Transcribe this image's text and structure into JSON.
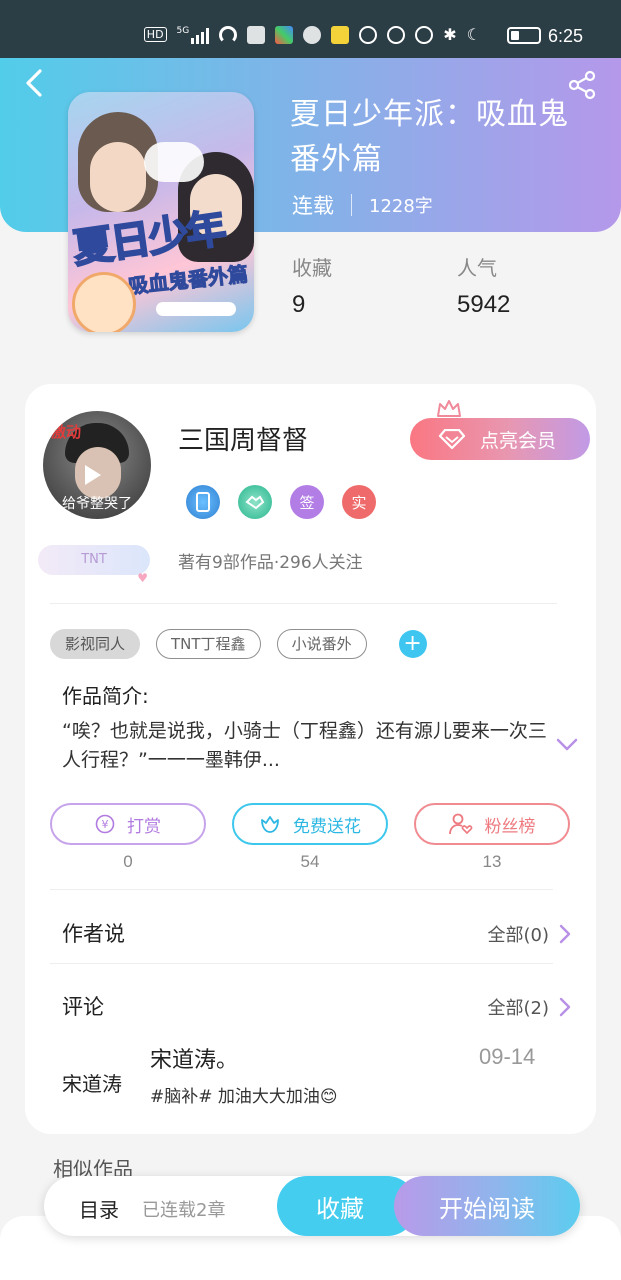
{
  "status_bar": {
    "time": "6:25",
    "network": "5G",
    "hd": "HD",
    "icons": [
      "hd-icon",
      "signal-icon",
      "wifi-icon",
      "tv-icon",
      "app-icon",
      "qq-icon",
      "chat-icon",
      "nfc-icon",
      "eye-icon",
      "alarm-icon",
      "bluetooth-icon",
      "moon-icon",
      "battery-icon"
    ]
  },
  "book": {
    "title": "夏日少年派：吸血鬼番外篇",
    "status": "连载",
    "word_count": "1228字",
    "stats": [
      {
        "label": "收藏",
        "value": "9"
      },
      {
        "label": "人气",
        "value": "5942"
      }
    ],
    "cover_logo": "夏日少年派",
    "cover_subtitle": "吸血鬼番外篇"
  },
  "author": {
    "name": "三国周督督",
    "avatar_caption": "给爷整哭了",
    "avatar_red_text": "激动",
    "fan_badge": "TNT",
    "badges": [
      {
        "name": "phone-badge-icon",
        "text": ""
      },
      {
        "name": "handshake-badge-icon",
        "text": ""
      },
      {
        "name": "sign-badge",
        "text": "签"
      },
      {
        "name": "verified-badge",
        "text": "实"
      }
    ],
    "works_info": "著有9部作品·296人关注",
    "vip_button": "点亮会员"
  },
  "tags": [
    "影视同人",
    "TNT丁程鑫",
    "小说番外"
  ],
  "intro": {
    "label": "作品简介:",
    "text": "“唉？也就是说我，小骑士（丁程鑫）还有源儿要来一次三人行程？”一一一墨韩伊..."
  },
  "actions": [
    {
      "label": "打赏",
      "count": "0"
    },
    {
      "label": "免费送花",
      "count": "54"
    },
    {
      "label": "粉丝榜",
      "count": "13"
    }
  ],
  "author_says": {
    "label": "作者说",
    "link": "全部(0)"
  },
  "comments": {
    "label": "评论",
    "link": "全部(2)",
    "items": [
      {
        "user": "宋道涛",
        "name": "宋道涛。",
        "date": "09-14",
        "text": "#脑补# 加油大大加油😊"
      }
    ]
  },
  "similar_label": "相似作品",
  "bottom": {
    "toc": "目录",
    "chapters": "已连载2章",
    "favorite": "收藏",
    "read": "开始阅读"
  },
  "colors": {
    "header_start": "#52cde9",
    "header_end": "#b598ea",
    "accent_blue": "#45cdef",
    "accent_purple": "#b89ae9",
    "vip_pink": "#fa7782"
  }
}
